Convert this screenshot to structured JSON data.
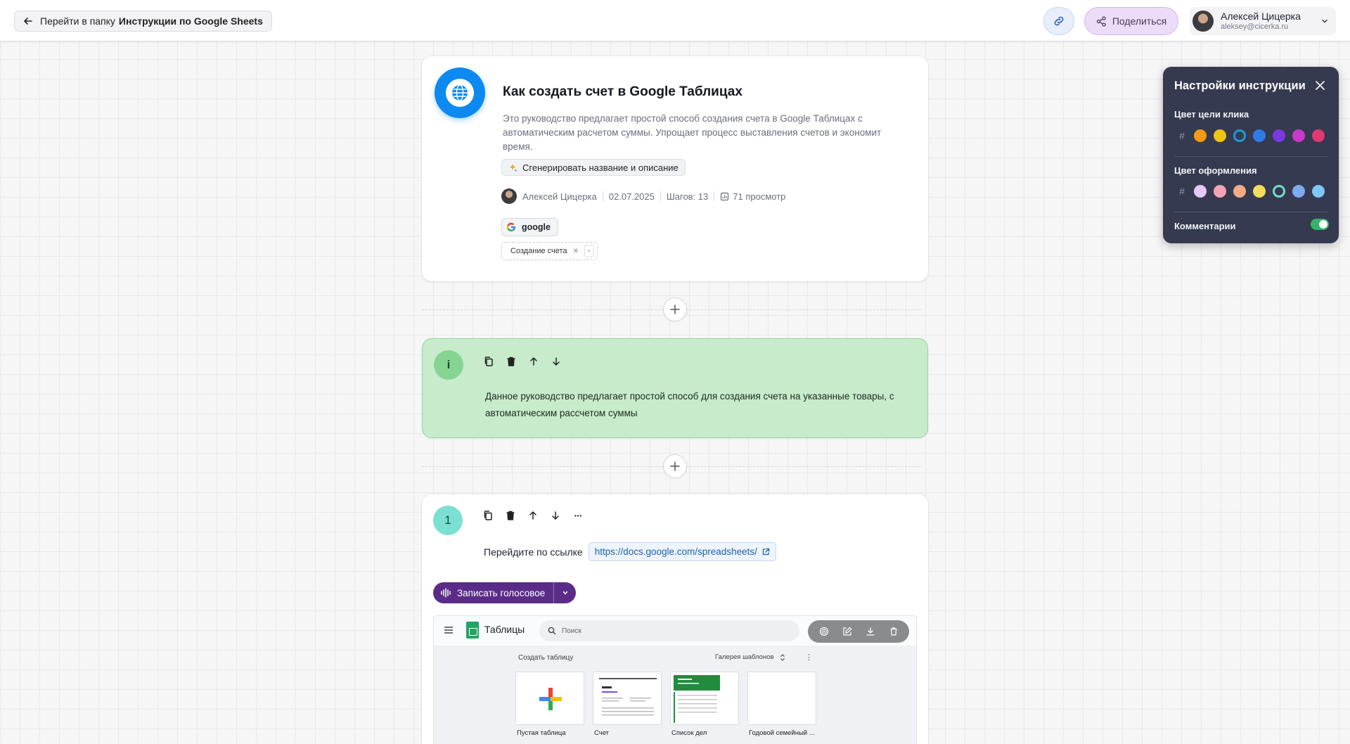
{
  "topbar": {
    "back_prefix": "Перейти в папку",
    "back_folder": "Инструкции по Google Sheets",
    "share_label": "Поделиться",
    "user_name": "Алексей Цицерка",
    "user_email": "aleksey@cicerka.ru"
  },
  "doc": {
    "title": "Как создать счет в Google Таблицах",
    "description": "Это руководство предлагает простой способ создания счета в Google Таблицах с автоматическим расчетом суммы. Упрощает процесс выставления счетов и экономит время.",
    "generate_label": "Сгенерировать название и описание",
    "author": "Алексей Цицерка",
    "date": "02.07.2025",
    "steps": "Шагов: 13",
    "views": "71 просмотр",
    "app_tag": "google",
    "chip": "Создание счета",
    "chip_plus": "+"
  },
  "info_block": {
    "badge": "i",
    "text": "Данное руководство предлагает простой способ для создания счета на указанные товары, с автоматическим рассчетом суммы"
  },
  "step1": {
    "badge": "1",
    "text": "Перейдите по ссылке",
    "url": "https://docs.google.com/spreadsheets/",
    "more": "···",
    "voice_label": "Записать голосовое"
  },
  "screenshot": {
    "app_name": "Таблицы",
    "search_placeholder": "Поиск",
    "create_label": "Создать таблицу",
    "gallery_label": "Галерея шаблонов",
    "templates": [
      "Пустая таблица",
      "Счет",
      "Список дел",
      "Годовой семейный ..."
    ],
    "kebab": "⋮"
  },
  "settings": {
    "title": "Настройки инструкции",
    "click_color_label": "Цвет цели клика",
    "design_color_label": "Цвет оформления",
    "comments_label": "Комментарии",
    "hash": "#",
    "click_colors": [
      "#f39a14",
      "#f1c313",
      "#1d9bd7",
      "#2e7be6",
      "#7a39e0",
      "#c93ac9",
      "#e33772"
    ],
    "click_selected_index": 2,
    "design_colors": [
      "#e8c8f4",
      "#f4a2b4",
      "#f4ab86",
      "#f4dc5c",
      "#6fe0cf",
      "#7eaaf2",
      "#7ec8f4"
    ],
    "design_selected_index": 4,
    "comments_enabled": true
  }
}
